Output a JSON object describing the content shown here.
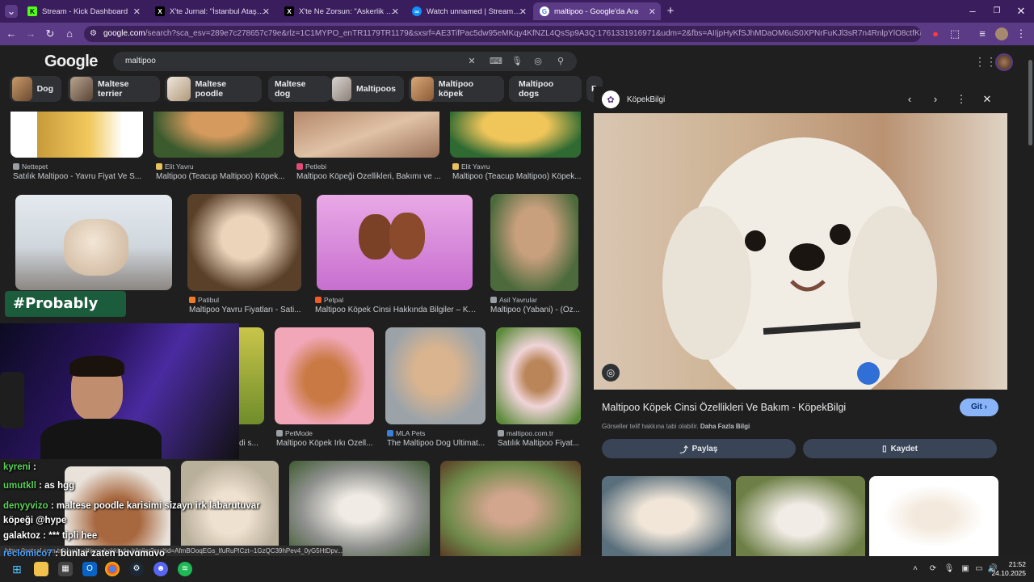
{
  "tabs": [
    {
      "label": "Stream - Kick Dashboard",
      "fav_text": "K",
      "fav_color": "#53fc18"
    },
    {
      "label": "X'te Jurnal: \"İstanbul Ataşehir'd",
      "fav_text": "X",
      "fav_color": "#000000"
    },
    {
      "label": "X'te Ne Zorsun: \"Askerlik anısı",
      "fav_text": "X",
      "fav_color": "#000000"
    },
    {
      "label": "Watch unnamed | Streamable",
      "fav_text": "∞",
      "fav_color": "#0f90fa"
    },
    {
      "label": "maltipoo - Google'da Ara",
      "fav_text": "G",
      "fav_color": "#ffffff"
    }
  ],
  "url": {
    "host": "google.com",
    "rest": "/search?sca_esv=289e7c278657c79e&rlz=1C1MYPO_enTR1179TR1179&sxsrf=AE3TifPac5dw95eMKqy4KfNZL4QsSp9A3Q:1761331916971&udm=2&fbs=AIIjpHyKfSJhMDaOM6uS0XPNrFuKJl3sR7n4RnlpYlO8ctfKhzgTxwD1Bc8..."
  },
  "google": {
    "logo": "Google",
    "query": "maltipoo"
  },
  "chips": [
    "Dog",
    "Maltese terrier",
    "Maltese poodle",
    "Maltese dog",
    "Maltipoos",
    "Maltipoo köpek",
    "Maltipoo dogs",
    "P"
  ],
  "results": {
    "row1": [
      {
        "source": "Nettepet",
        "title": "Satılık Maltipoo - Yavru Fiyat Ve S..."
      },
      {
        "source": "Elit Yavru",
        "title": "Maltipoo (Teacup Maltipoo) Köpek..."
      },
      {
        "source": "Petlebi",
        "title": "Maltipoo Köpeği Özellikleri, Bakımı ve ..."
      },
      {
        "source": "Elit Yavru",
        "title": "Maltipoo (Teacup Maltipoo) Köpek..."
      }
    ],
    "row2": [
      {
        "source": "Patibul",
        "title": "Maltipoo Yavru Fiyatları - Sati..."
      },
      {
        "source": "Petpal",
        "title": "Maltipoo Köpek Cinsi Hakkında Bilgiler – Ka..."
      },
      {
        "source": "Asil Yavrular",
        "title": "Maltipoo (Yabani) - (Öz..."
      }
    ],
    "row3": [
      {
        "source": "",
        "title": "di s..."
      },
      {
        "source": "PetMode",
        "title": "Maltipoo Köpek Irkı Özell..."
      },
      {
        "source": "MLA Pets",
        "title": "The Maltipoo Dog Ultimat..."
      },
      {
        "source": "maltipoo.com.tr",
        "title": "Satılık Maltipoo Fiyat..."
      }
    ]
  },
  "panel": {
    "site": "KöpekBilgi",
    "title": "Maltipoo Köpek Cinsi Özellikleri Ve Bakım - KöpekBilgi",
    "go": "Git",
    "note": "Görseller telif hakkına tabi olabilir.",
    "note_link": "Daha Fazla Bilgi",
    "share": "Paylaş",
    "save": "Kaydet"
  },
  "overlay": {
    "probably": "#Probably",
    "chat": [
      {
        "user": "kyreni",
        "msg": ":",
        "color": "#5ad25a"
      },
      {
        "user": "umutkll",
        "msg": ": as hgg",
        "color": "#5ad25a"
      },
      {
        "user": "denyyvizo",
        "msg": ": maltese poodle karisimi sizayn irk labarutuvar köpeği @hype",
        "color": "#5ad25a"
      },
      {
        "user": "galaktoz",
        "msg": ": *** tipli hee",
        "color": "#ffffff"
      },
      {
        "user": "reclomico7",
        "msg": ": bunlar zaten bgygmgyo",
        "color": "#4aa3ff"
      }
    ]
  },
  "status_url": "https://petsal.com.tr/blog/maltipoo-hakkinda-bilgiler?srsltid=AfmBOoqEGs_lfuRuPlCzt--1GzQC39hPev4_0yG5HtDpv...",
  "clock": {
    "time": "21:52",
    "date": "24.10.2025"
  },
  "colors": {
    "chrome": "#5b3a86",
    "tabbar": "#3a1d5c",
    "page_bg": "#1f1f1f",
    "accent": "#8ab4f8"
  }
}
